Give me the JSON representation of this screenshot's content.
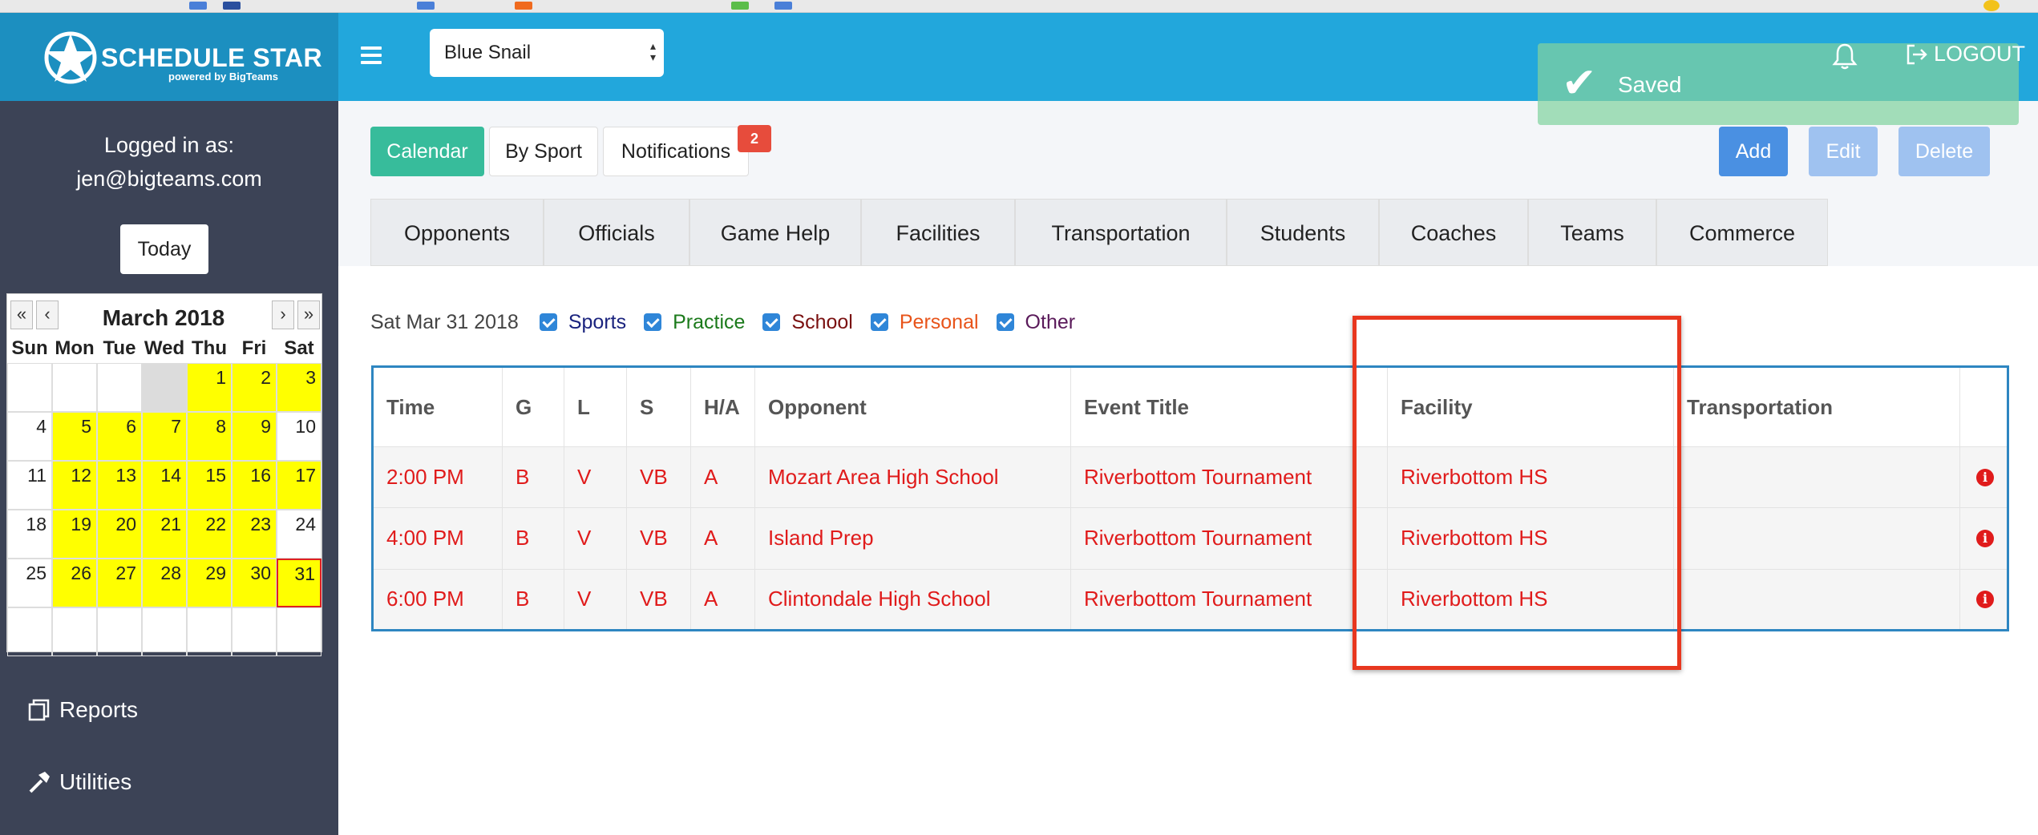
{
  "brand": {
    "name": "SCHEDULE STAR",
    "sub": "powered by BigTeams"
  },
  "team_select": {
    "value": "Blue Snail"
  },
  "toast": {
    "text": "Saved"
  },
  "header": {
    "logout_label": "LOGOUT"
  },
  "sidebar": {
    "logged_in_label": "Logged in as:",
    "user_email": "jen@bigteams.com",
    "today_label": "Today",
    "reports_label": "Reports",
    "utilities_label": "Utilities"
  },
  "mini_calendar": {
    "title": "March 2018",
    "nav": [
      "«",
      "‹",
      "›",
      "»"
    ],
    "dow": [
      "Sun",
      "Mon",
      "Tue",
      "Wed",
      "Thu",
      "Fri",
      "Sat"
    ],
    "cells": [
      {
        "d": "",
        "hl": false
      },
      {
        "d": "",
        "hl": false
      },
      {
        "d": "",
        "hl": false
      },
      {
        "d": "",
        "grey": true
      },
      {
        "d": "1",
        "hl": true
      },
      {
        "d": "2",
        "hl": true
      },
      {
        "d": "3",
        "hl": true
      },
      {
        "d": "4",
        "hl": false
      },
      {
        "d": "5",
        "hl": true
      },
      {
        "d": "6",
        "hl": true
      },
      {
        "d": "7",
        "hl": true
      },
      {
        "d": "8",
        "hl": true
      },
      {
        "d": "9",
        "hl": true
      },
      {
        "d": "10",
        "hl": false
      },
      {
        "d": "11",
        "hl": false
      },
      {
        "d": "12",
        "hl": true
      },
      {
        "d": "13",
        "hl": true
      },
      {
        "d": "14",
        "hl": true
      },
      {
        "d": "15",
        "hl": true
      },
      {
        "d": "16",
        "hl": true
      },
      {
        "d": "17",
        "hl": true
      },
      {
        "d": "18",
        "hl": false
      },
      {
        "d": "19",
        "hl": true
      },
      {
        "d": "20",
        "hl": true
      },
      {
        "d": "21",
        "hl": true
      },
      {
        "d": "22",
        "hl": true
      },
      {
        "d": "23",
        "hl": true
      },
      {
        "d": "24",
        "hl": false
      },
      {
        "d": "25",
        "hl": false
      },
      {
        "d": "26",
        "hl": true
      },
      {
        "d": "27",
        "hl": true
      },
      {
        "d": "28",
        "hl": true
      },
      {
        "d": "29",
        "hl": true
      },
      {
        "d": "30",
        "hl": true
      },
      {
        "d": "31",
        "hl": true,
        "sel": true
      },
      {
        "d": "",
        "hl": false
      },
      {
        "d": "",
        "hl": false
      },
      {
        "d": "",
        "hl": false
      },
      {
        "d": "",
        "hl": false
      },
      {
        "d": "",
        "hl": false
      },
      {
        "d": "",
        "hl": false
      },
      {
        "d": "",
        "hl": false
      }
    ]
  },
  "toolbar": {
    "calendar_label": "Calendar",
    "by_sport_label": "By Sport",
    "notifications_label": "Notifications",
    "notifications_count": "2",
    "add_label": "Add",
    "edit_label": "Edit",
    "delete_label": "Delete"
  },
  "tabs": [
    "Opponents",
    "Officials",
    "Game Help",
    "Facilities",
    "Transportation",
    "Students",
    "Coaches",
    "Teams",
    "Commerce"
  ],
  "filters": {
    "date": "Sat Mar 31 2018",
    "items": [
      {
        "label": "Sports",
        "color": "#1a237e"
      },
      {
        "label": "Practice",
        "color": "#1b7a1b"
      },
      {
        "label": "School",
        "color": "#7a1010"
      },
      {
        "label": "Personal",
        "color": "#e8541a"
      },
      {
        "label": "Other",
        "color": "#5a1a5a"
      }
    ]
  },
  "events_table": {
    "columns": [
      "Time",
      "G",
      "L",
      "S",
      "H/A",
      "Opponent",
      "Event Title",
      "Facility",
      "Transportation",
      ""
    ],
    "rows": [
      [
        "2:00 PM",
        "B",
        "V",
        "VB",
        "A",
        "Mozart Area High School",
        "Riverbottom Tournament",
        "Riverbottom HS",
        ""
      ],
      [
        "4:00 PM",
        "B",
        "V",
        "VB",
        "A",
        "Island Prep",
        "Riverbottom Tournament",
        "Riverbottom HS",
        ""
      ],
      [
        "6:00 PM",
        "B",
        "V",
        "VB",
        "A",
        "Clintondale High School",
        "Riverbottom Tournament",
        "Riverbottom HS",
        ""
      ]
    ]
  },
  "colors": {
    "topbar": "#22a7dc",
    "sidebar": "#3c4356",
    "accent_green": "#37bc9b",
    "event_red": "#e01b1b",
    "highlight_box": "#e8371f"
  }
}
